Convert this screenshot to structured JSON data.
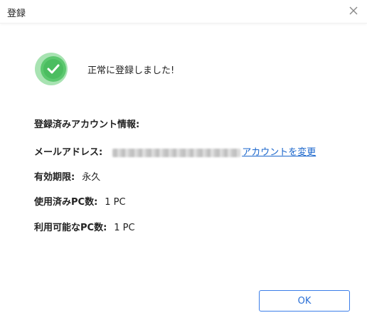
{
  "window": {
    "title": "登録",
    "close_icon": "close-icon"
  },
  "status": {
    "icon": "check-circle-icon",
    "icon_color": "#5cc86f",
    "message": "正常に登録しました!"
  },
  "account_info": {
    "section_title": "登録済みアカウント情報:",
    "email_label": "メールアドレス:",
    "change_account_link": "アカウントを変更",
    "expiry_label": "有効期限:",
    "expiry_value": "永久",
    "used_pc_label": "使用済みPC数:",
    "used_pc_value": "1 PC",
    "available_pc_label": "利用可能なPC数:",
    "available_pc_value": "1 PC"
  },
  "footer": {
    "ok_label": "OK"
  },
  "colors": {
    "link": "#1a66cc",
    "button_border": "#3b7de9",
    "success_green": "#5cc86f"
  }
}
